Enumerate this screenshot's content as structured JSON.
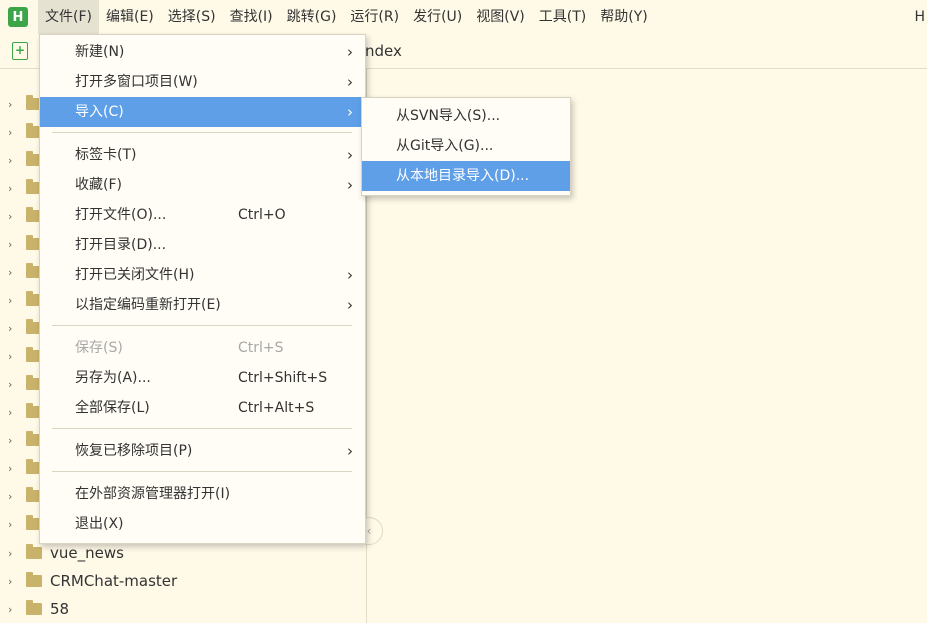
{
  "menubar": {
    "logo": "H",
    "items": [
      "文件(F)",
      "编辑(E)",
      "选择(S)",
      "查找(I)",
      "跳转(G)",
      "运行(R)",
      "发行(U)",
      "视图(V)",
      "工具(T)",
      "帮助(Y)"
    ],
    "right_text": "H"
  },
  "toolbar": {
    "tab_label": "ndex"
  },
  "sidebar": {
    "items": [
      {
        "label": ""
      },
      {
        "label": ""
      },
      {
        "label": ""
      },
      {
        "label": ""
      },
      {
        "label": ""
      },
      {
        "label": ""
      },
      {
        "label": ""
      },
      {
        "label": ""
      },
      {
        "label": ""
      },
      {
        "label": ""
      },
      {
        "label": ""
      },
      {
        "label": ""
      },
      {
        "label": ""
      },
      {
        "label": ""
      },
      {
        "label": ""
      },
      {
        "label": ""
      },
      {
        "label": ""
      },
      {
        "label": "vue_news"
      },
      {
        "label": "CRMChat-master"
      },
      {
        "label": "58"
      }
    ]
  },
  "file_menu": {
    "new": {
      "label": "新建(N)"
    },
    "open_multi": {
      "label": "打开多窗口项目(W)"
    },
    "import": {
      "label": "导入(C)"
    },
    "tabs": {
      "label": "标签卡(T)"
    },
    "favorites": {
      "label": "收藏(F)"
    },
    "open_file": {
      "label": "打开文件(O)...",
      "shortcut": "Ctrl+O"
    },
    "open_dir": {
      "label": "打开目录(D)..."
    },
    "open_closed": {
      "label": "打开已关闭文件(H)"
    },
    "reopen_encoding": {
      "label": "以指定编码重新打开(E)"
    },
    "save": {
      "label": "保存(S)",
      "shortcut": "Ctrl+S"
    },
    "save_as": {
      "label": "另存为(A)...",
      "shortcut": "Ctrl+Shift+S"
    },
    "save_all": {
      "label": "全部保存(L)",
      "shortcut": "Ctrl+Alt+S"
    },
    "restore_removed": {
      "label": "恢复已移除项目(P)"
    },
    "open_in_explorer": {
      "label": "在外部资源管理器打开(I)"
    },
    "exit": {
      "label": "退出(X)"
    }
  },
  "import_submenu": {
    "from_svn": "从SVN导入(S)...",
    "from_git": "从Git导入(G)...",
    "from_local": "从本地目录导入(D)..."
  },
  "colors": {
    "accent": "#5e9fe8",
    "background": "#fffae8",
    "logo": "#3ca548"
  }
}
